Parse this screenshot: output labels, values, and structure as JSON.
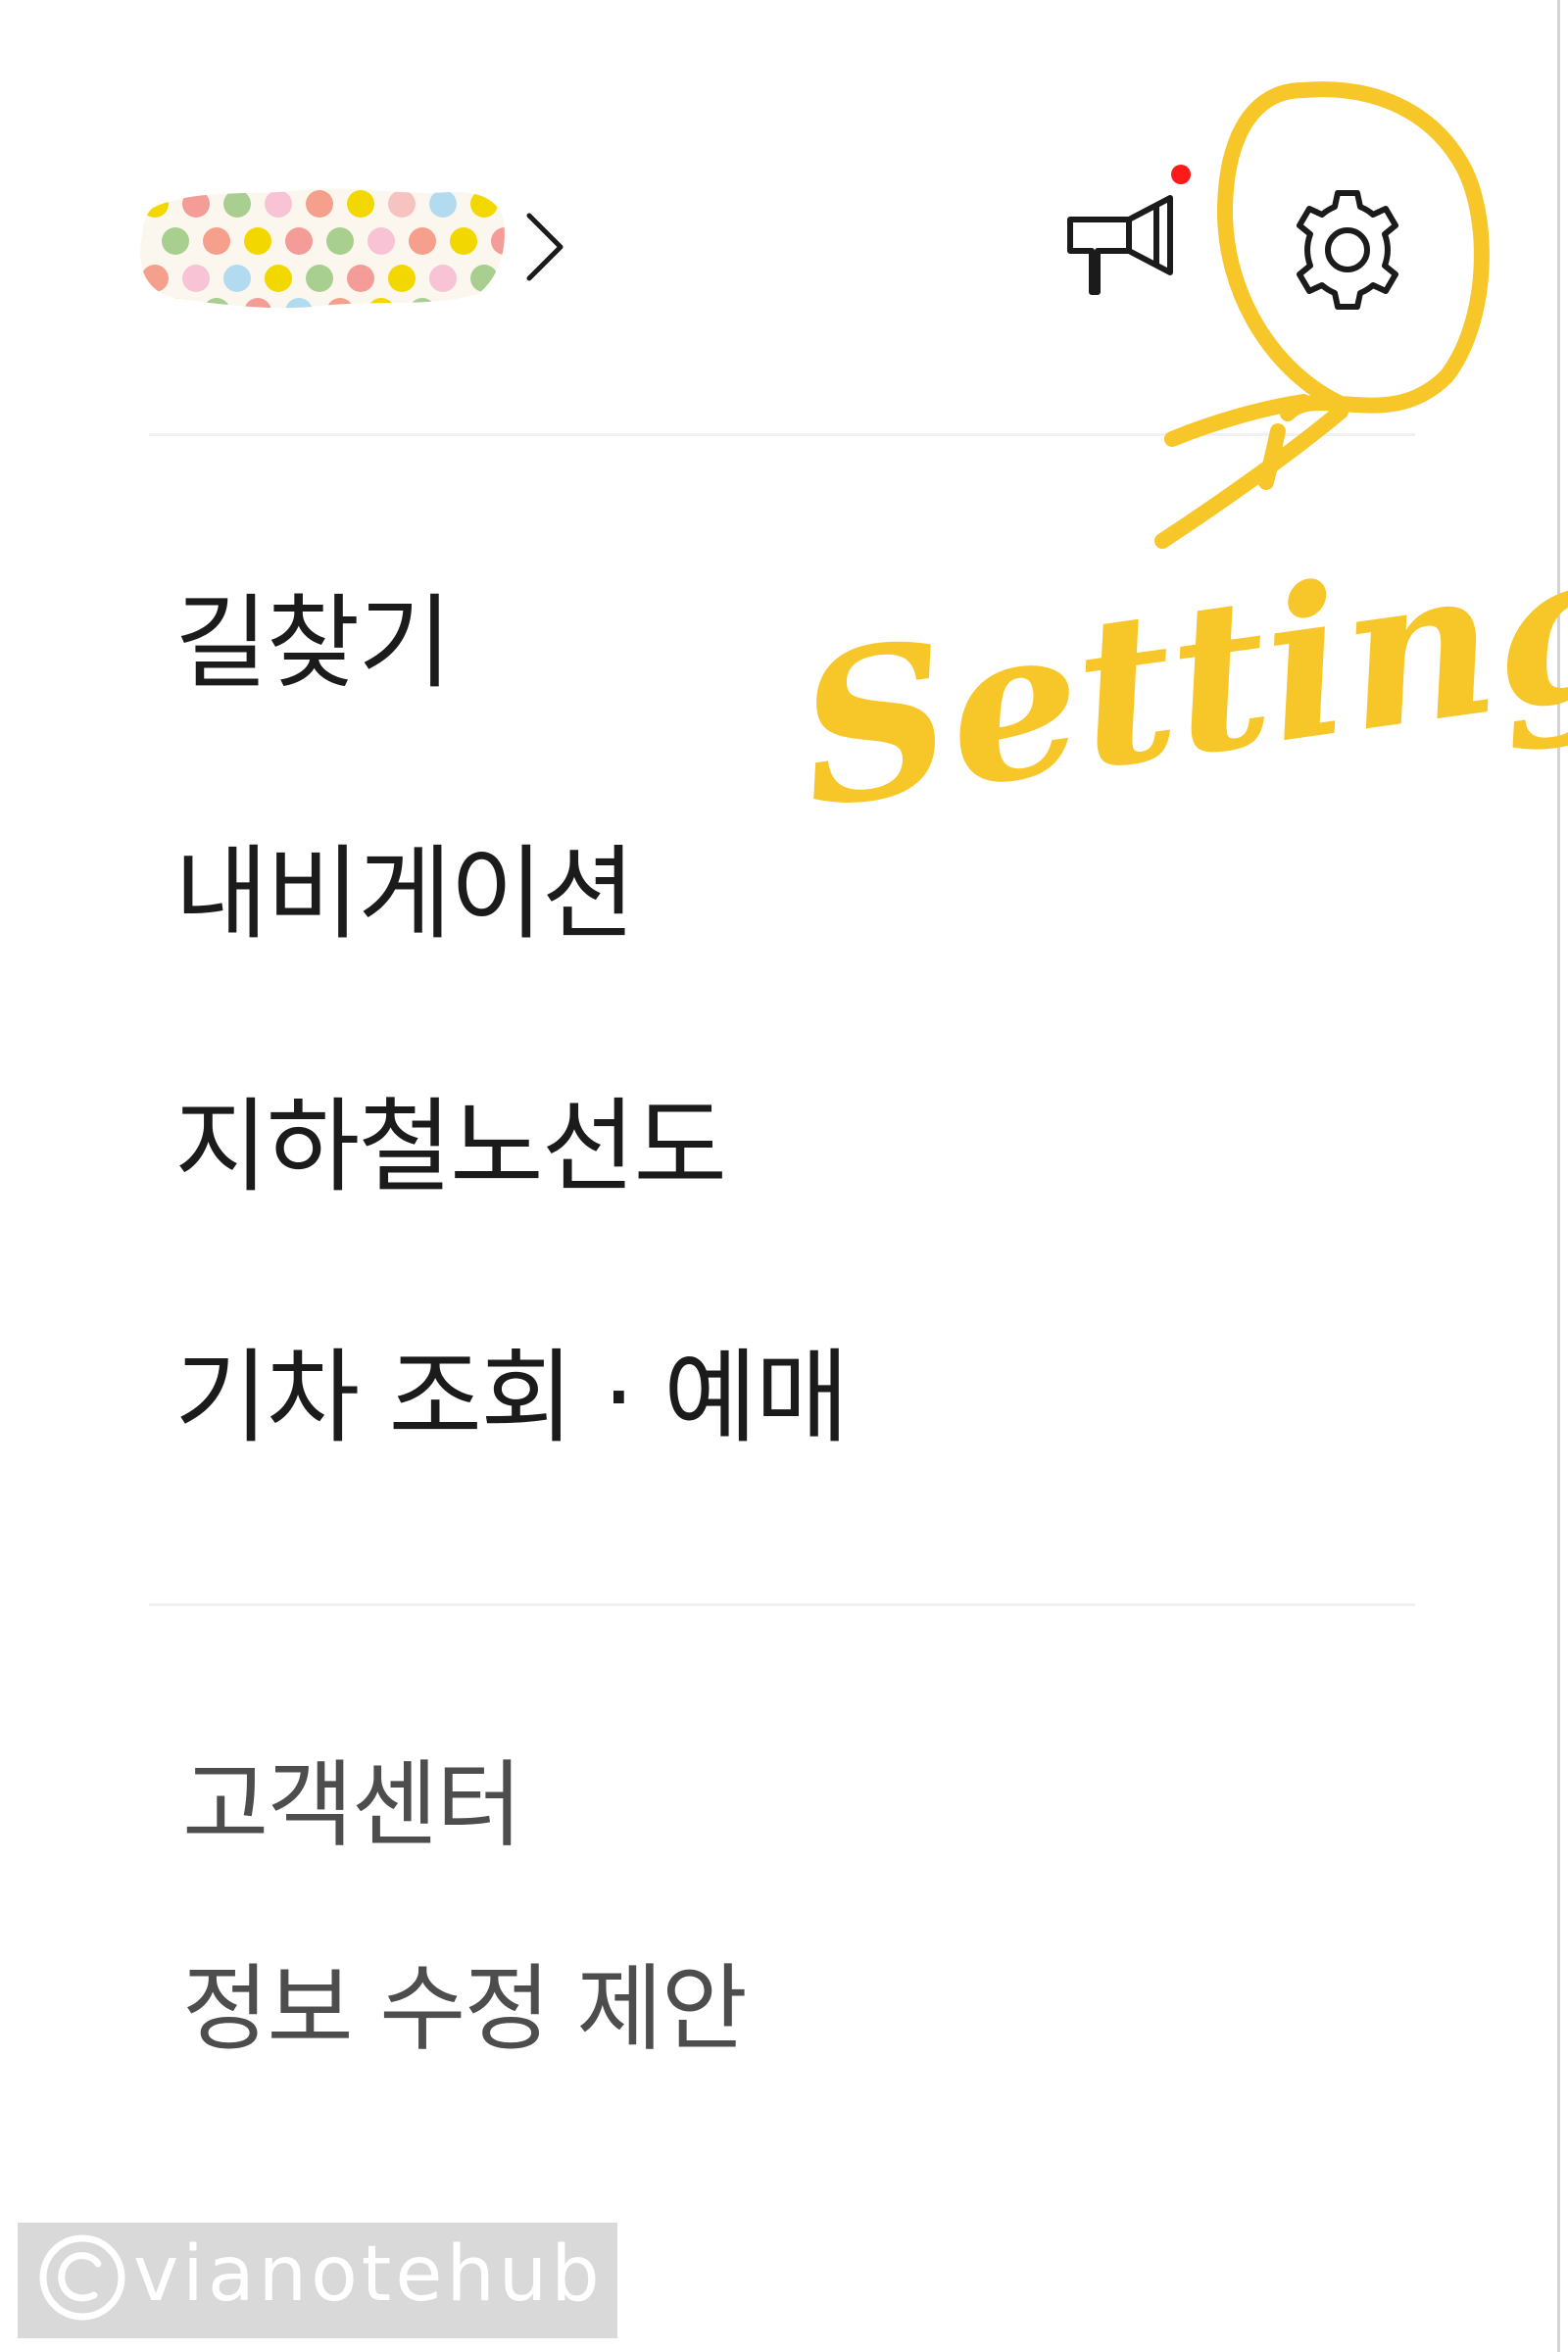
{
  "header": {
    "profile_name_hidden": true,
    "profile_chevron_icon": "chevron-right-icon",
    "notice_icon": "megaphone-icon",
    "notice_badge_color": "#ff1a1a",
    "settings_icon": "gear-icon"
  },
  "menu": {
    "items": [
      {
        "label": "길찾기"
      },
      {
        "label": "내비게이션"
      },
      {
        "label": "지하철노선도"
      },
      {
        "label": "기차 조회 · 예매"
      }
    ]
  },
  "footer_menu": {
    "items": [
      {
        "label": "고객센터"
      },
      {
        "label": "정보 수정 제안"
      }
    ]
  },
  "annotation": {
    "label": "Setting",
    "color": "#f7c72a"
  },
  "watermark": {
    "text": "vianotehub",
    "symbol": "©"
  }
}
